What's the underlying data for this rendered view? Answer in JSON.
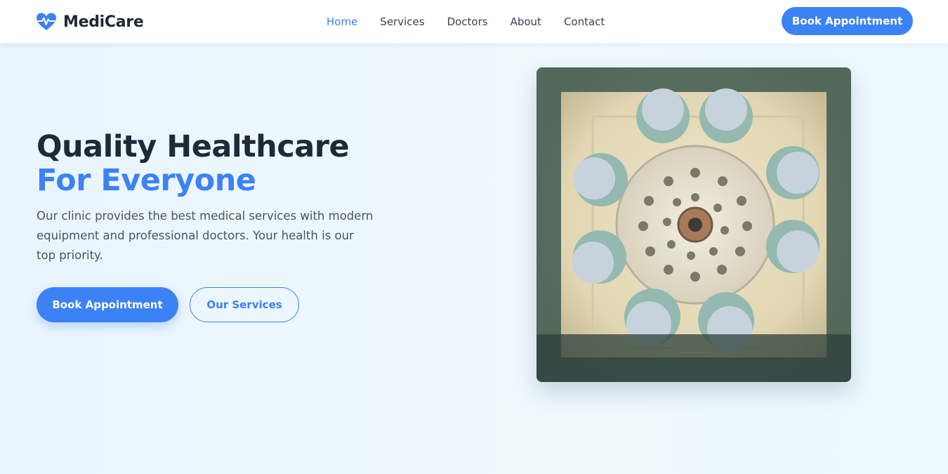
{
  "brand": {
    "name": "MediCare",
    "icon": "heart-pulse-icon",
    "accent_color": "#3b82f6"
  },
  "nav": {
    "links": [
      "Home",
      "Services",
      "Doctors",
      "About",
      "Contact"
    ],
    "active_index": 0,
    "cta_label": "Book Appointment"
  },
  "hero": {
    "headline_line1": "Quality Healthcare",
    "headline_line2": "For Everyone",
    "description": "Our clinic provides the best medical services with modern equipment and professional doctors. Your health is our top priority.",
    "primary_button": "Book Appointment",
    "secondary_button": "Our Services",
    "image_subject": "surgeons-looking-down-photo"
  }
}
